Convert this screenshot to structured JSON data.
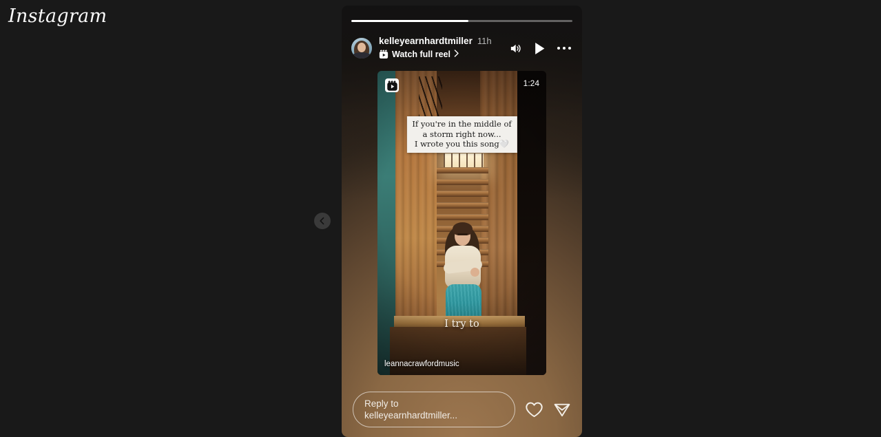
{
  "brand": {
    "wordmark": "Instagram"
  },
  "nav": {
    "prev_label": "chevron-left-icon"
  },
  "story": {
    "progress": {
      "percent": 53
    },
    "header": {
      "username": "kelleyearnhardtmiller",
      "time_ago": "11h",
      "watch_reel_label": "Watch full reel",
      "chevron": "›",
      "actions": {
        "volume": "volume-on-icon",
        "play": "play-icon",
        "more": "more-options-icon"
      }
    },
    "media": {
      "reel_badge": "reel-icon",
      "duration": "1:24",
      "sticker_lines": [
        "If you're in the middle of",
        "a storm right now...",
        "I wrote you this song"
      ],
      "sticker_emoji": "🤍",
      "lyric_caption": "I try to",
      "creator_handle": "leannacrawfordmusic"
    },
    "reply": {
      "placeholder": "Reply to kelleyearnhardtmiller...",
      "like_label": "like-icon",
      "share_label": "share-icon"
    }
  },
  "colors": {
    "page_bg": "#191919",
    "story_warm": "#8a6844",
    "accent_white": "#ffffff"
  }
}
